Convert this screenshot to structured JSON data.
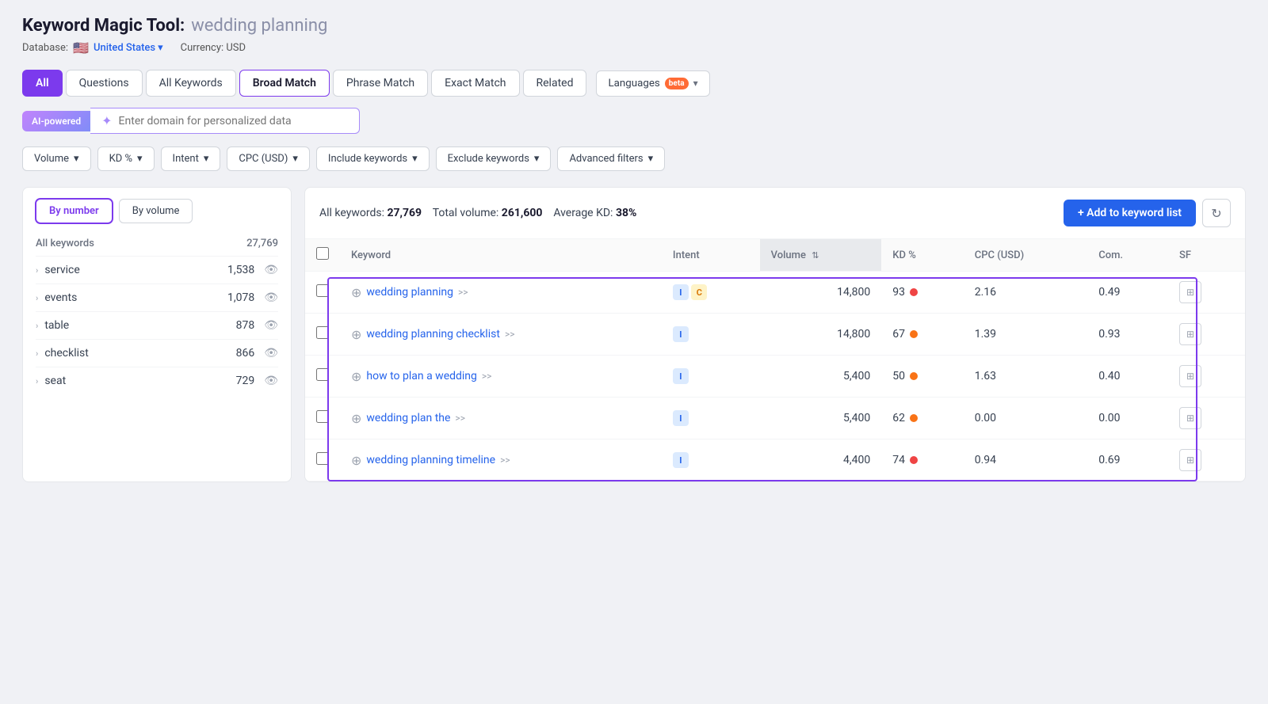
{
  "header": {
    "title_tool": "Keyword Magic Tool:",
    "title_query": "wedding planning",
    "database_label": "Database:",
    "database_value": "United States",
    "currency": "Currency: USD"
  },
  "tabs": [
    {
      "id": "all",
      "label": "All",
      "active": false,
      "all": true
    },
    {
      "id": "questions",
      "label": "Questions",
      "active": false
    },
    {
      "id": "all-keywords",
      "label": "All Keywords",
      "active": false
    },
    {
      "id": "broad-match",
      "label": "Broad Match",
      "active": true
    },
    {
      "id": "phrase-match",
      "label": "Phrase Match",
      "active": false
    },
    {
      "id": "exact-match",
      "label": "Exact Match",
      "active": false
    },
    {
      "id": "related",
      "label": "Related",
      "active": false
    }
  ],
  "languages_tab": {
    "label": "Languages",
    "badge": "beta"
  },
  "ai_section": {
    "label": "AI-powered",
    "placeholder": "Enter domain for personalized data"
  },
  "filters": [
    {
      "id": "volume",
      "label": "Volume",
      "has_dropdown": true
    },
    {
      "id": "kd",
      "label": "KD %",
      "has_dropdown": true
    },
    {
      "id": "intent",
      "label": "Intent",
      "has_dropdown": true
    },
    {
      "id": "cpc",
      "label": "CPC (USD)",
      "has_dropdown": true
    },
    {
      "id": "include-keywords",
      "label": "Include keywords",
      "has_dropdown": true
    },
    {
      "id": "exclude-keywords",
      "label": "Exclude keywords",
      "has_dropdown": true
    },
    {
      "id": "advanced-filters",
      "label": "Advanced filters",
      "has_dropdown": true
    }
  ],
  "sidebar": {
    "controls": {
      "by_number": "By number",
      "by_volume": "By volume"
    },
    "header": {
      "all_keywords": "All keywords",
      "count": "27,769"
    },
    "items": [
      {
        "label": "service",
        "count": "1,538"
      },
      {
        "label": "events",
        "count": "1,078"
      },
      {
        "label": "table",
        "count": "878"
      },
      {
        "label": "checklist",
        "count": "866"
      },
      {
        "label": "seat",
        "count": "729"
      }
    ]
  },
  "table": {
    "stats": {
      "all_keywords_label": "All keywords:",
      "all_keywords_value": "27,769",
      "total_volume_label": "Total volume:",
      "total_volume_value": "261,600",
      "avg_kd_label": "Average KD:",
      "avg_kd_value": "38%"
    },
    "add_button": "+ Add to keyword list",
    "columns": [
      {
        "id": "keyword",
        "label": "Keyword"
      },
      {
        "id": "intent",
        "label": "Intent"
      },
      {
        "id": "volume",
        "label": "Volume",
        "sortable": true,
        "highlighted": true
      },
      {
        "id": "kd",
        "label": "KD %"
      },
      {
        "id": "cpc",
        "label": "CPC (USD)"
      },
      {
        "id": "com",
        "label": "Com."
      },
      {
        "id": "sf",
        "label": "SF"
      }
    ],
    "rows": [
      {
        "keyword": "wedding planning",
        "intents": [
          "I",
          "C"
        ],
        "volume": "14,800",
        "kd": "93",
        "kd_color": "red",
        "cpc": "2.16",
        "com": "0.49"
      },
      {
        "keyword": "wedding planning checklist",
        "intents": [
          "I"
        ],
        "volume": "14,800",
        "kd": "67",
        "kd_color": "orange",
        "cpc": "1.39",
        "com": "0.93"
      },
      {
        "keyword": "how to plan a wedding",
        "intents": [
          "I"
        ],
        "volume": "5,400",
        "kd": "50",
        "kd_color": "orange",
        "cpc": "1.63",
        "com": "0.40"
      },
      {
        "keyword": "wedding plan the",
        "intents": [
          "I"
        ],
        "volume": "5,400",
        "kd": "62",
        "kd_color": "orange",
        "cpc": "0.00",
        "com": "0.00"
      },
      {
        "keyword": "wedding planning timeline",
        "intents": [
          "I"
        ],
        "volume": "4,400",
        "kd": "74",
        "kd_color": "red",
        "cpc": "0.94",
        "com": "0.69"
      }
    ]
  }
}
